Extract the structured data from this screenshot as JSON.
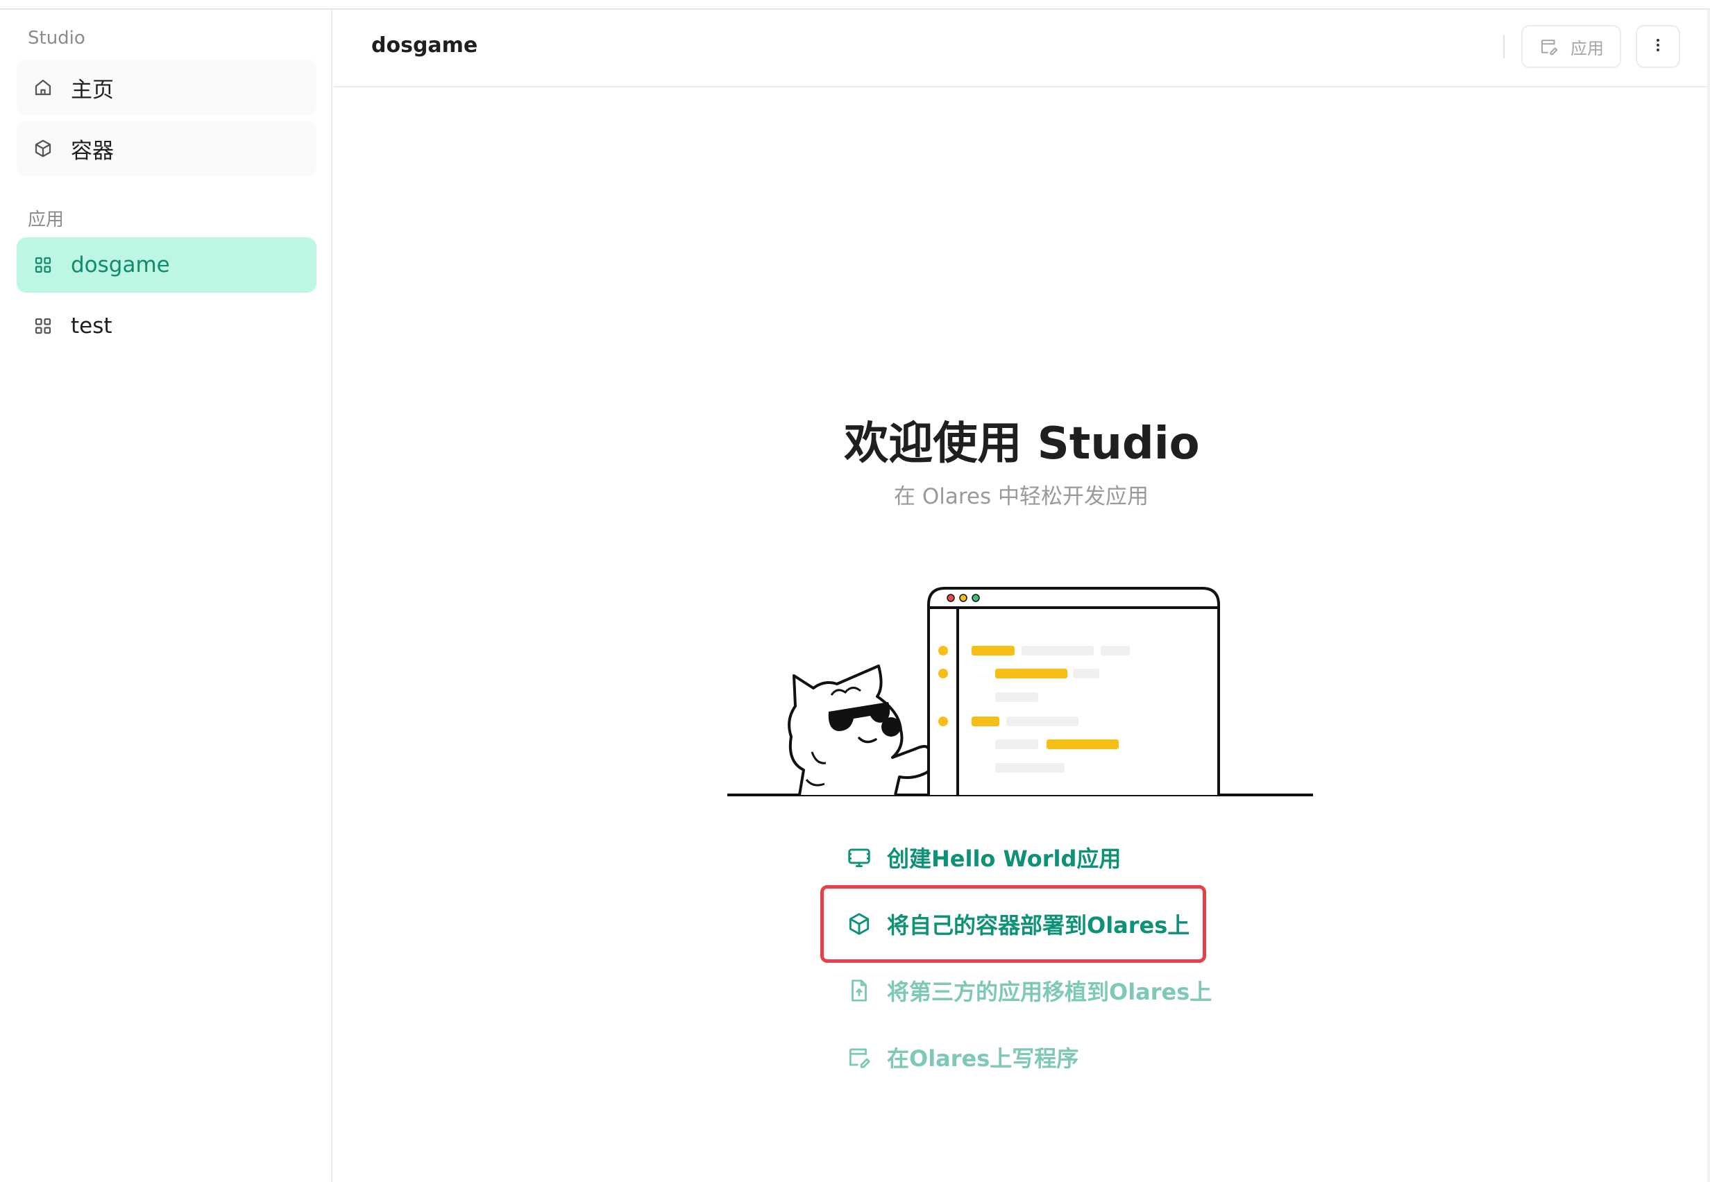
{
  "sidebar": {
    "app_name": "Studio",
    "nav": [
      {
        "label": "主页",
        "icon": "home-icon"
      },
      {
        "label": "容器",
        "icon": "cube-icon"
      }
    ],
    "apps_section_label": "应用",
    "apps": [
      {
        "label": "dosgame",
        "icon": "grid-icon",
        "active": true
      },
      {
        "label": "test",
        "icon": "grid-icon",
        "active": false
      }
    ]
  },
  "header": {
    "title": "dosgame",
    "apply_label": "应用",
    "more_icon": "more-vertical-icon"
  },
  "main": {
    "welcome_title": "欢迎使用 Studio",
    "welcome_subtitle": "在 Olares 中轻松开发应用",
    "actions": [
      {
        "label": "创建Hello World应用",
        "icon": "monitor-icon",
        "style": "strong"
      },
      {
        "label": "将自己的容器部署到Olares上",
        "icon": "cube-icon",
        "style": "strong",
        "highlighted": true
      },
      {
        "label": "将第三方的应用移植到Olares上",
        "icon": "file-upload-icon",
        "style": "soft"
      },
      {
        "label": "在Olares上写程序",
        "icon": "edit-app-icon",
        "style": "soft"
      }
    ]
  },
  "colors": {
    "accent": "#0d9177",
    "active_bg": "#bdf7e3",
    "highlight_border": "#e8404a",
    "illustration_yellow": "#f7be16"
  }
}
